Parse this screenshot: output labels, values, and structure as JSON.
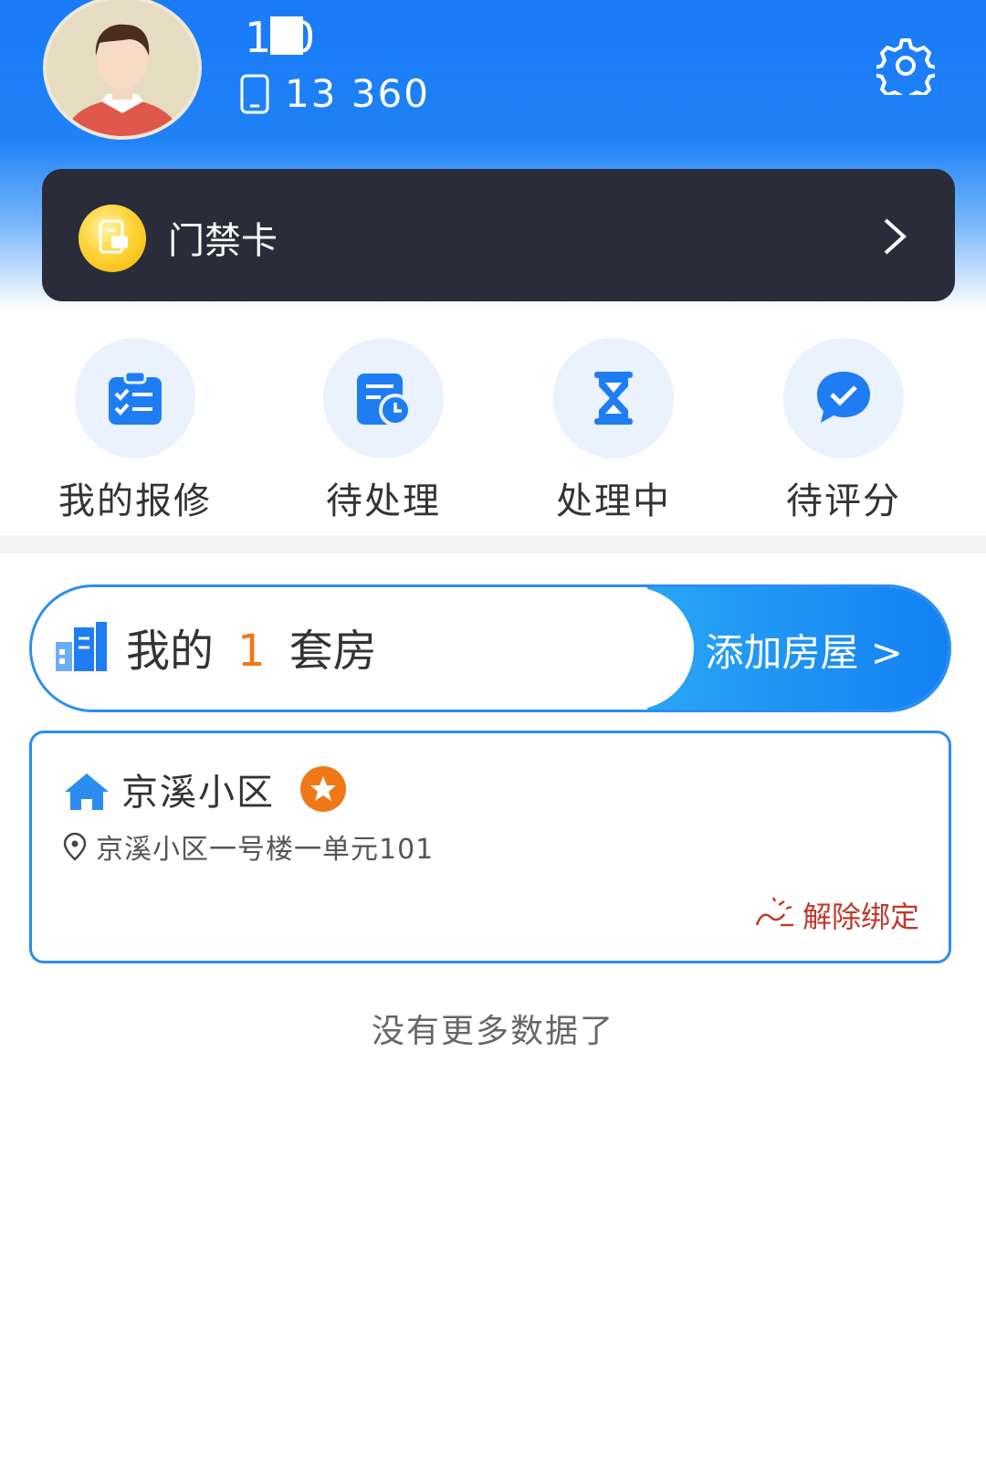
{
  "profile": {
    "name": "1    0",
    "phone": "13          360"
  },
  "access_card": {
    "label": "门禁卡"
  },
  "quick_actions": [
    {
      "label": "我的报修",
      "icon": "clipboard-checklist-icon"
    },
    {
      "label": "待处理",
      "icon": "calendar-clock-icon"
    },
    {
      "label": "处理中",
      "icon": "hourglass-icon"
    },
    {
      "label": "待评分",
      "icon": "chat-check-icon"
    }
  ],
  "houses": {
    "title_prefix": "我的",
    "count": "1",
    "title_suffix": "套房",
    "add_label": "添加房屋 >"
  },
  "house_card": {
    "community": "京溪小区",
    "address": "京溪小区一号楼一单元101",
    "unbind_label": "解除绑定"
  },
  "footer": {
    "no_more": "没有更多数据了"
  },
  "colors": {
    "header_blue": "#1a7af8",
    "card_dark": "#2a2c3a",
    "accent_orange": "#f07818",
    "unbind_red": "#c0392b"
  }
}
